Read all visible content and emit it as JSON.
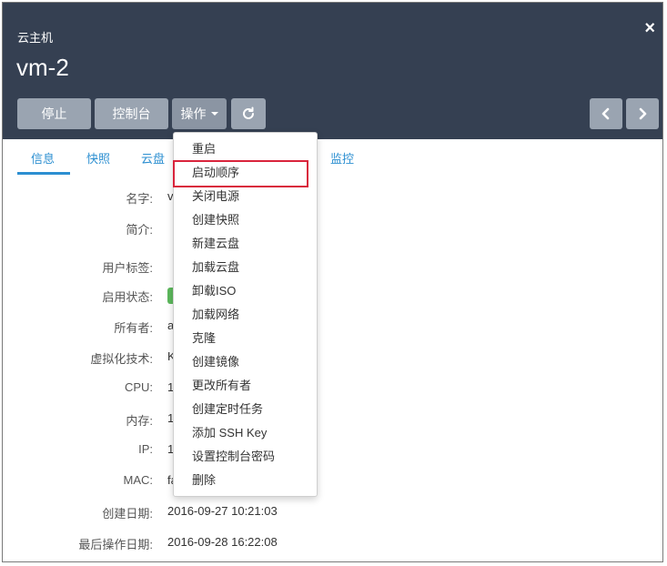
{
  "header": {
    "subtitle": "云主机",
    "title": "vm-2",
    "close_icon": "×"
  },
  "toolbar": {
    "stop_label": "停止",
    "console_label": "控制台",
    "actions_label": "操作",
    "refresh_icon": "⟳",
    "prev_icon": "‹",
    "next_icon": "›"
  },
  "tabs": [
    {
      "label": "信息"
    },
    {
      "label": "快照"
    },
    {
      "label": "云盘"
    },
    {
      "label": "监控"
    }
  ],
  "info": {
    "name_label": "名字:",
    "name_value": "v",
    "desc_label": "简介:",
    "tags_label": "用户标签:",
    "state_label": "启用状态:",
    "owner_label": "所有者:",
    "owner_value": "a",
    "virt_label": "虚拟化技术:",
    "virt_value": "K",
    "cpu_label": "CPU:",
    "cpu_value": "1",
    "mem_label": "内存:",
    "mem_value": "1",
    "ip_label": "IP:",
    "ip_value": "1",
    "mac_label": "MAC:",
    "mac_value": "fa",
    "created_label": "创建日期:",
    "created_value": "2016-09-27 10:21:03",
    "lastop_label": "最后操作日期:",
    "lastop_value": "2016-09-28 16:22:08"
  },
  "menu": {
    "items": [
      {
        "label": "重启"
      },
      {
        "label": "启动顺序"
      },
      {
        "label": "关闭电源"
      },
      {
        "label": "创建快照"
      },
      {
        "label": "新建云盘"
      },
      {
        "label": "加载云盘"
      },
      {
        "label": "卸载ISO"
      },
      {
        "label": "加载网络"
      },
      {
        "label": "克隆"
      },
      {
        "label": "创建镜像"
      },
      {
        "label": "更改所有者"
      },
      {
        "label": "创建定时任务"
      },
      {
        "label": "添加 SSH Key"
      },
      {
        "label": "设置控制台密码"
      },
      {
        "label": "删除"
      }
    ],
    "highlighted_index": 1
  },
  "colors": {
    "header_bg": "#354052",
    "button_bg": "#9aa4b1",
    "tab_accent": "#2c8fd1",
    "highlight_border": "#d9243c",
    "status_green": "#5cb85c"
  }
}
